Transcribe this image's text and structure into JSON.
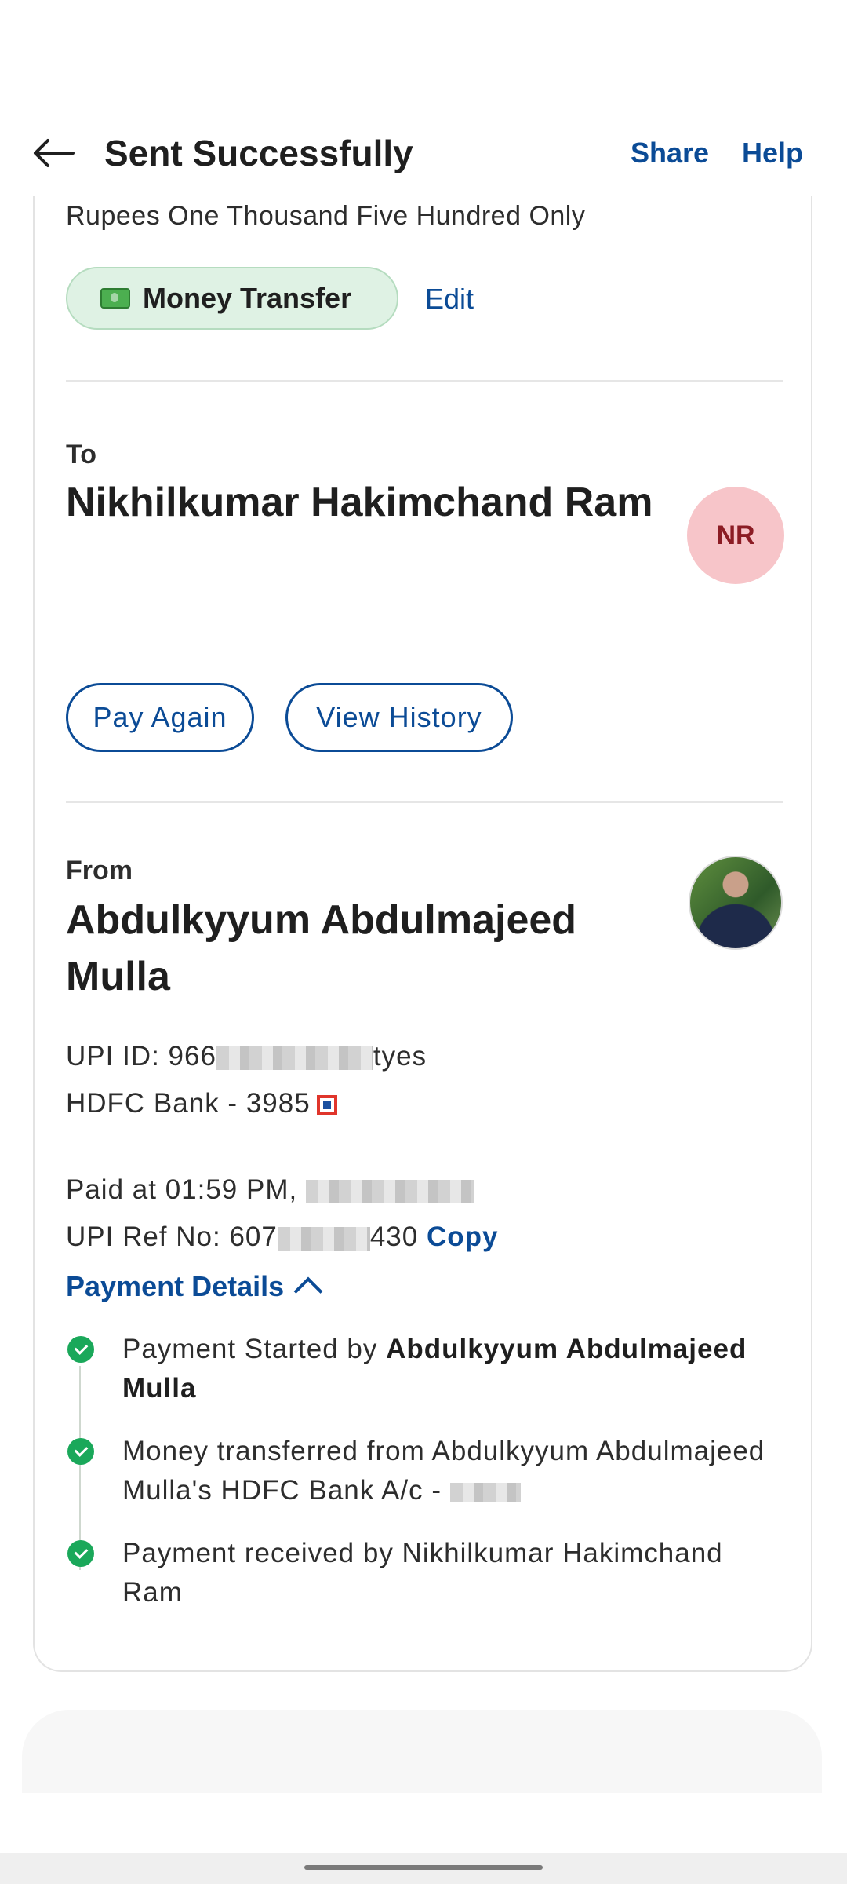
{
  "header": {
    "title": "Sent Successfully",
    "share_label": "Share",
    "help_label": "Help"
  },
  "amount_in_words": "Rupees One Thousand Five Hundred Only",
  "category_tag": {
    "label": "Money Transfer",
    "icon": "money-icon",
    "edit_label": "Edit"
  },
  "recipient": {
    "label": "To",
    "name": "Nikhilkumar Hakimchand Ram",
    "initials": "NR"
  },
  "actions": {
    "pay_again": "Pay Again",
    "view_history": "View History"
  },
  "sender": {
    "label": "From",
    "name": "Abdulkyyum Abdulmajeed Mulla",
    "upi_id_prefix": "UPI ID: 966",
    "upi_id_suffix": "tyes",
    "bank": "HDFC Bank - 3985"
  },
  "transaction": {
    "paid_at": "Paid at 01:59 PM,",
    "ref_prefix": "UPI Ref No: 607",
    "ref_suffix": "430",
    "copy_label": "Copy"
  },
  "payment_details": {
    "toggle_label": "Payment Details",
    "steps": [
      {
        "text": "Payment Started by ",
        "bold": "Abdulkyyum Abdulmajeed Mulla"
      },
      {
        "text": "Money transferred from Abdulkyyum Abdulmajeed Mulla's HDFC Bank A/c - "
      },
      {
        "text": "Payment received by Nikhilkumar Hakimchand Ram"
      }
    ]
  },
  "colors": {
    "accent": "#0b4b96",
    "success": "#1aa85a",
    "tag_bg": "#dff2e4",
    "avatar_bg": "#f7c5c9"
  }
}
